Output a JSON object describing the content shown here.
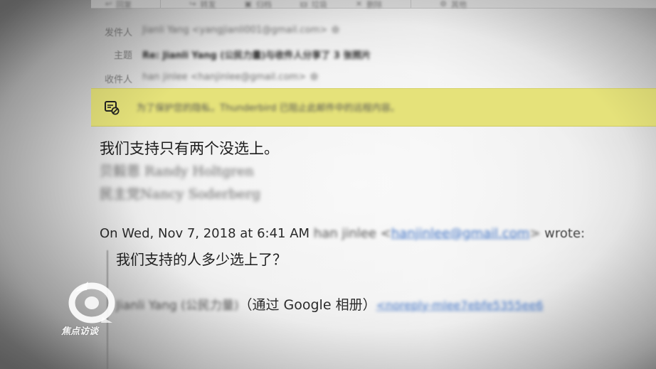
{
  "toolbar": {
    "buttons": [
      "回复",
      "转发",
      "归档",
      "垃圾",
      "删除",
      "其他"
    ]
  },
  "headers": {
    "from_label": "发件人",
    "from_value": "Jianli Yang <yangjianli001@gmail.com>",
    "subject_label": "主题",
    "subject_value": "Re: Jianli Yang (公民力量)与收件人分享了 3 张照片",
    "to_label": "收件人",
    "to_value": "han jinlee <hanjinlee@gmail.com>"
  },
  "banner": {
    "text": "为了保护您的隐私，Thunderbird 已阻止此邮件中的远程内容。",
    "icon": "remote-content-blocked-icon"
  },
  "body": {
    "main_line": "我们支持只有两个没选上。",
    "signature_1": "贝毅恩 Randy Holtgren",
    "signature_2": "民主党Nancy Soderberg"
  },
  "quote": {
    "header_prefix": "On Wed, Nov 7, 2018 at 6:41 AM",
    "sender_name": "han jinlee",
    "sender_email_open": "<",
    "sender_email": "hanjinlee@gmail.com",
    "sender_email_close": ">",
    "wrote": "wrote:",
    "body_line": "我们支持的人多少选上了？",
    "forward_name": "Jianli Yang (公民力量)",
    "forward_via": "（通过 Google 相册）",
    "forward_email": "<noreply-mlee7ebfe5355ee6"
  },
  "watermark": {
    "text": "焦点访谈"
  },
  "colors": {
    "banner_bg": "#e5e27a",
    "link": "#3a6fc4"
  }
}
